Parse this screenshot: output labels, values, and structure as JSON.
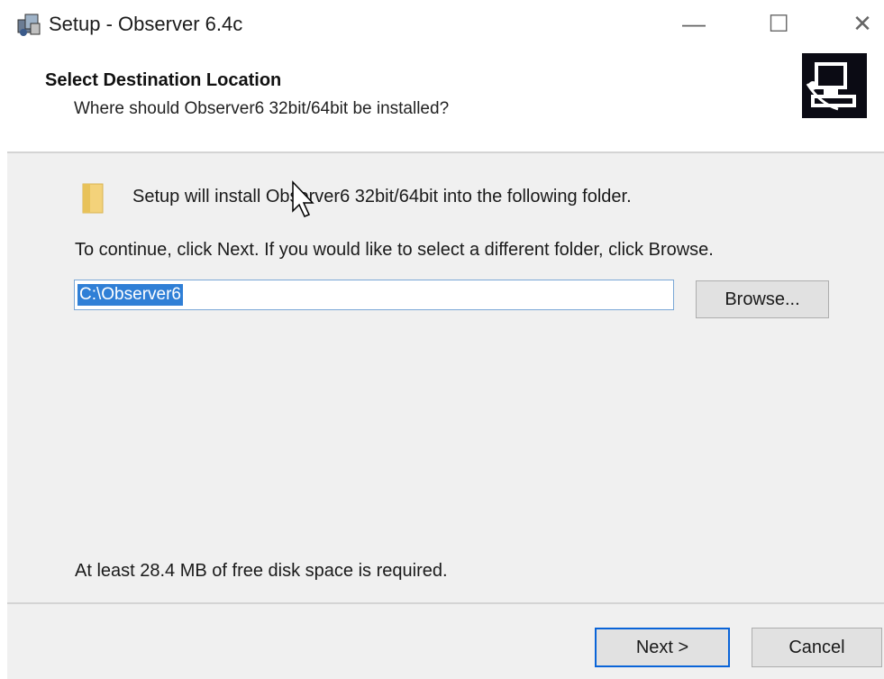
{
  "window": {
    "title": "Setup - Observer 6.4c",
    "controls": {
      "minimize": "—",
      "maximize": "☐",
      "close": "✕"
    }
  },
  "header": {
    "title": "Select Destination Location",
    "subtitle": "Where should Observer6 32bit/64bit be installed?",
    "icon": "installer-computer-icon"
  },
  "body": {
    "info": "Setup will install Observer6 32bit/64bit into the following folder.",
    "instruction": "To continue, click Next. If you would like to select a different folder, click Browse.",
    "path_value": "C:\\Observer6",
    "browse_label": "Browse...",
    "disk_space": "At least 28.4 MB of free disk space is required."
  },
  "footer": {
    "next_label": "Next >",
    "cancel_label": "Cancel"
  },
  "colors": {
    "panel": "#f0f0f0",
    "selection": "#2f7fd6",
    "default_button_border": "#0a64d8"
  }
}
